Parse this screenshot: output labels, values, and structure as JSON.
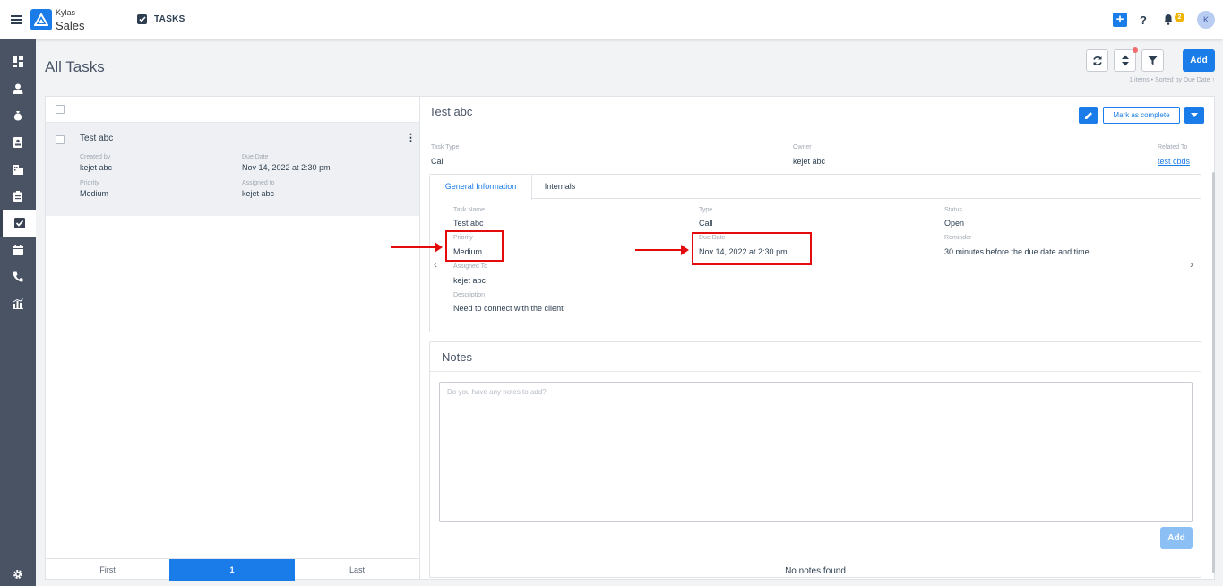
{
  "app": {
    "brand_top": "Kylas",
    "brand_bottom": "Sales",
    "module_title": "TASKS",
    "notification_count": "2",
    "avatar_initial": "K",
    "help_label": "?"
  },
  "page": {
    "title": "All Tasks",
    "add_label": "Add",
    "sort_info": "1 items • Sorted by  Due Date ↑"
  },
  "sidebar": {
    "items": [
      "dashboard-icon",
      "user-icon",
      "money-bag-icon",
      "contact-card-icon",
      "building-icon",
      "clipboard-icon",
      "checkbox-icon",
      "calendar-icon",
      "phone-icon",
      "chart-icon"
    ],
    "active": "checkbox-icon",
    "settings": "gear-icon"
  },
  "list": {
    "items": [
      {
        "title": "Test abc",
        "created_by_label": "Created by",
        "created_by": "kejet abc",
        "due_date_label": "Due Date",
        "due_date": "Nov 14, 2022 at 2:30 pm",
        "priority_label": "Priority",
        "priority": "Medium",
        "assigned_to_label": "Assigned to",
        "assigned_to": "kejet abc"
      }
    ],
    "pager": {
      "first": "First",
      "current": "1",
      "last": "Last"
    }
  },
  "detail": {
    "title": "Test abc",
    "mark_complete_label": "Mark as complete",
    "task_type_label": "Task Type",
    "task_type": "Call",
    "owner_label": "Owner",
    "owner": "kejet abc",
    "related_to_label": "Related To",
    "related_to": "test cbds",
    "tabs": [
      "General Information",
      "Internals"
    ],
    "fields": {
      "task_name_label": "Task Name",
      "task_name": "Test abc",
      "type_label": "Type",
      "type": "Call",
      "status_label": "Status",
      "status": "Open",
      "priority_label": "Priority",
      "priority": "Medium",
      "due_date_label": "Due Date",
      "due_date": "Nov 14, 2022 at 2:30 pm",
      "reminder_label": "Reminder",
      "reminder": "30 minutes before the due date and time",
      "assigned_to_label": "Assigned To",
      "assigned_to": "kejet abc",
      "description_label": "Description",
      "description": "Need to connect with the client"
    },
    "notes": {
      "title": "Notes",
      "placeholder": "Do you have any notes to add?",
      "add_label": "Add",
      "empty": "No notes found"
    }
  },
  "colors": {
    "accent": "#1a7ce8",
    "sidebar": "#4a5364",
    "highlight": "#e30b0b"
  }
}
